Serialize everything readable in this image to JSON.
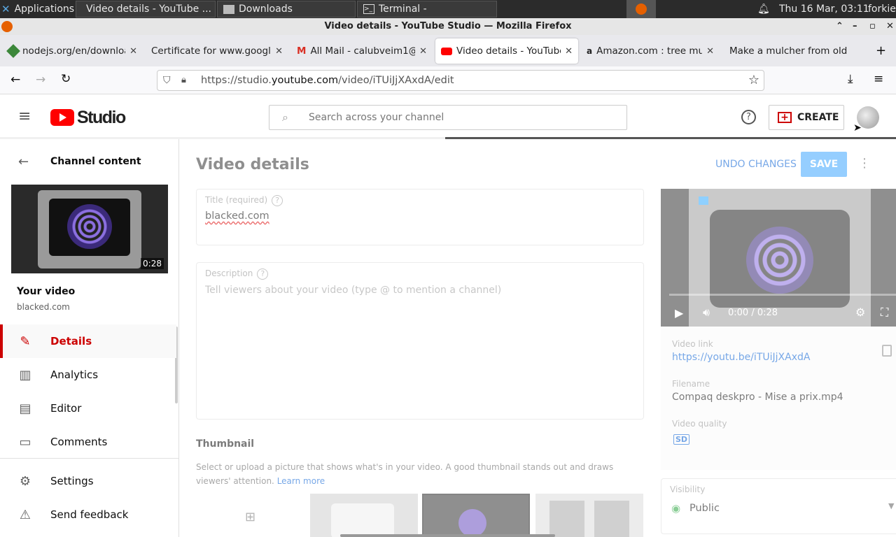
{
  "taskbar": {
    "applications": "Applications",
    "windows": [
      "Video details - YouTube ...",
      "Downloads",
      "Terminal -"
    ],
    "clock": "Thu 16 Mar, 03:11",
    "user": "forkie"
  },
  "window": {
    "title": "Video details - YouTube Studio — Mozilla Firefox"
  },
  "tabs": [
    {
      "label": "nodejs.org/en/downloa"
    },
    {
      "label": "Certificate for www.google"
    },
    {
      "label": "All Mail - calubveim1@"
    },
    {
      "label": "Video details - YouTube"
    },
    {
      "label": "Amazon.com : tree mu"
    },
    {
      "label": "Make a mulcher from old"
    }
  ],
  "url": {
    "prefix": "https://studio.",
    "domain": "youtube.com",
    "path": "/video/iTUiJjXAxdA/edit"
  },
  "header": {
    "logo": "Studio",
    "search_placeholder": "Search across your channel",
    "create": "CREATE"
  },
  "sidebar": {
    "back_label": "Channel content",
    "duration": "0:28",
    "your_video": "Your video",
    "video_title": "blacked.com",
    "items": [
      {
        "label": "Details",
        "icon": "pencil-icon"
      },
      {
        "label": "Analytics",
        "icon": "analytics-icon"
      },
      {
        "label": "Editor",
        "icon": "editor-icon"
      },
      {
        "label": "Comments",
        "icon": "comments-icon"
      },
      {
        "label": "Settings",
        "icon": "gear-icon"
      },
      {
        "label": "Send feedback",
        "icon": "feedback-icon"
      }
    ]
  },
  "main": {
    "page_title": "Video details",
    "undo": "UNDO CHANGES",
    "save": "SAVE",
    "title_label": "Title (required)",
    "title_value": "blacked.com",
    "desc_label": "Description",
    "desc_placeholder": "Tell viewers about your video (type @ to mention a channel)",
    "thumbnail_heading": "Thumbnail",
    "thumbnail_help": "Select or upload a picture that shows what's in your video. A good thumbnail stands out and draws viewers' attention.",
    "learn_more": "Learn more"
  },
  "player": {
    "time": "0:00 / 0:28"
  },
  "info": {
    "link_label": "Video link",
    "link": "https://youtu.be/iTUiJjXAxdA",
    "filename_label": "Filename",
    "filename": "Compaq deskpro - Mise a prix.mp4",
    "quality_label": "Video quality",
    "quality": "SD",
    "visibility_label": "Visibility",
    "visibility": "Public"
  },
  "colors": {
    "accent": "#cc0000",
    "link": "#065fd4",
    "save": "#3ea6ff"
  }
}
